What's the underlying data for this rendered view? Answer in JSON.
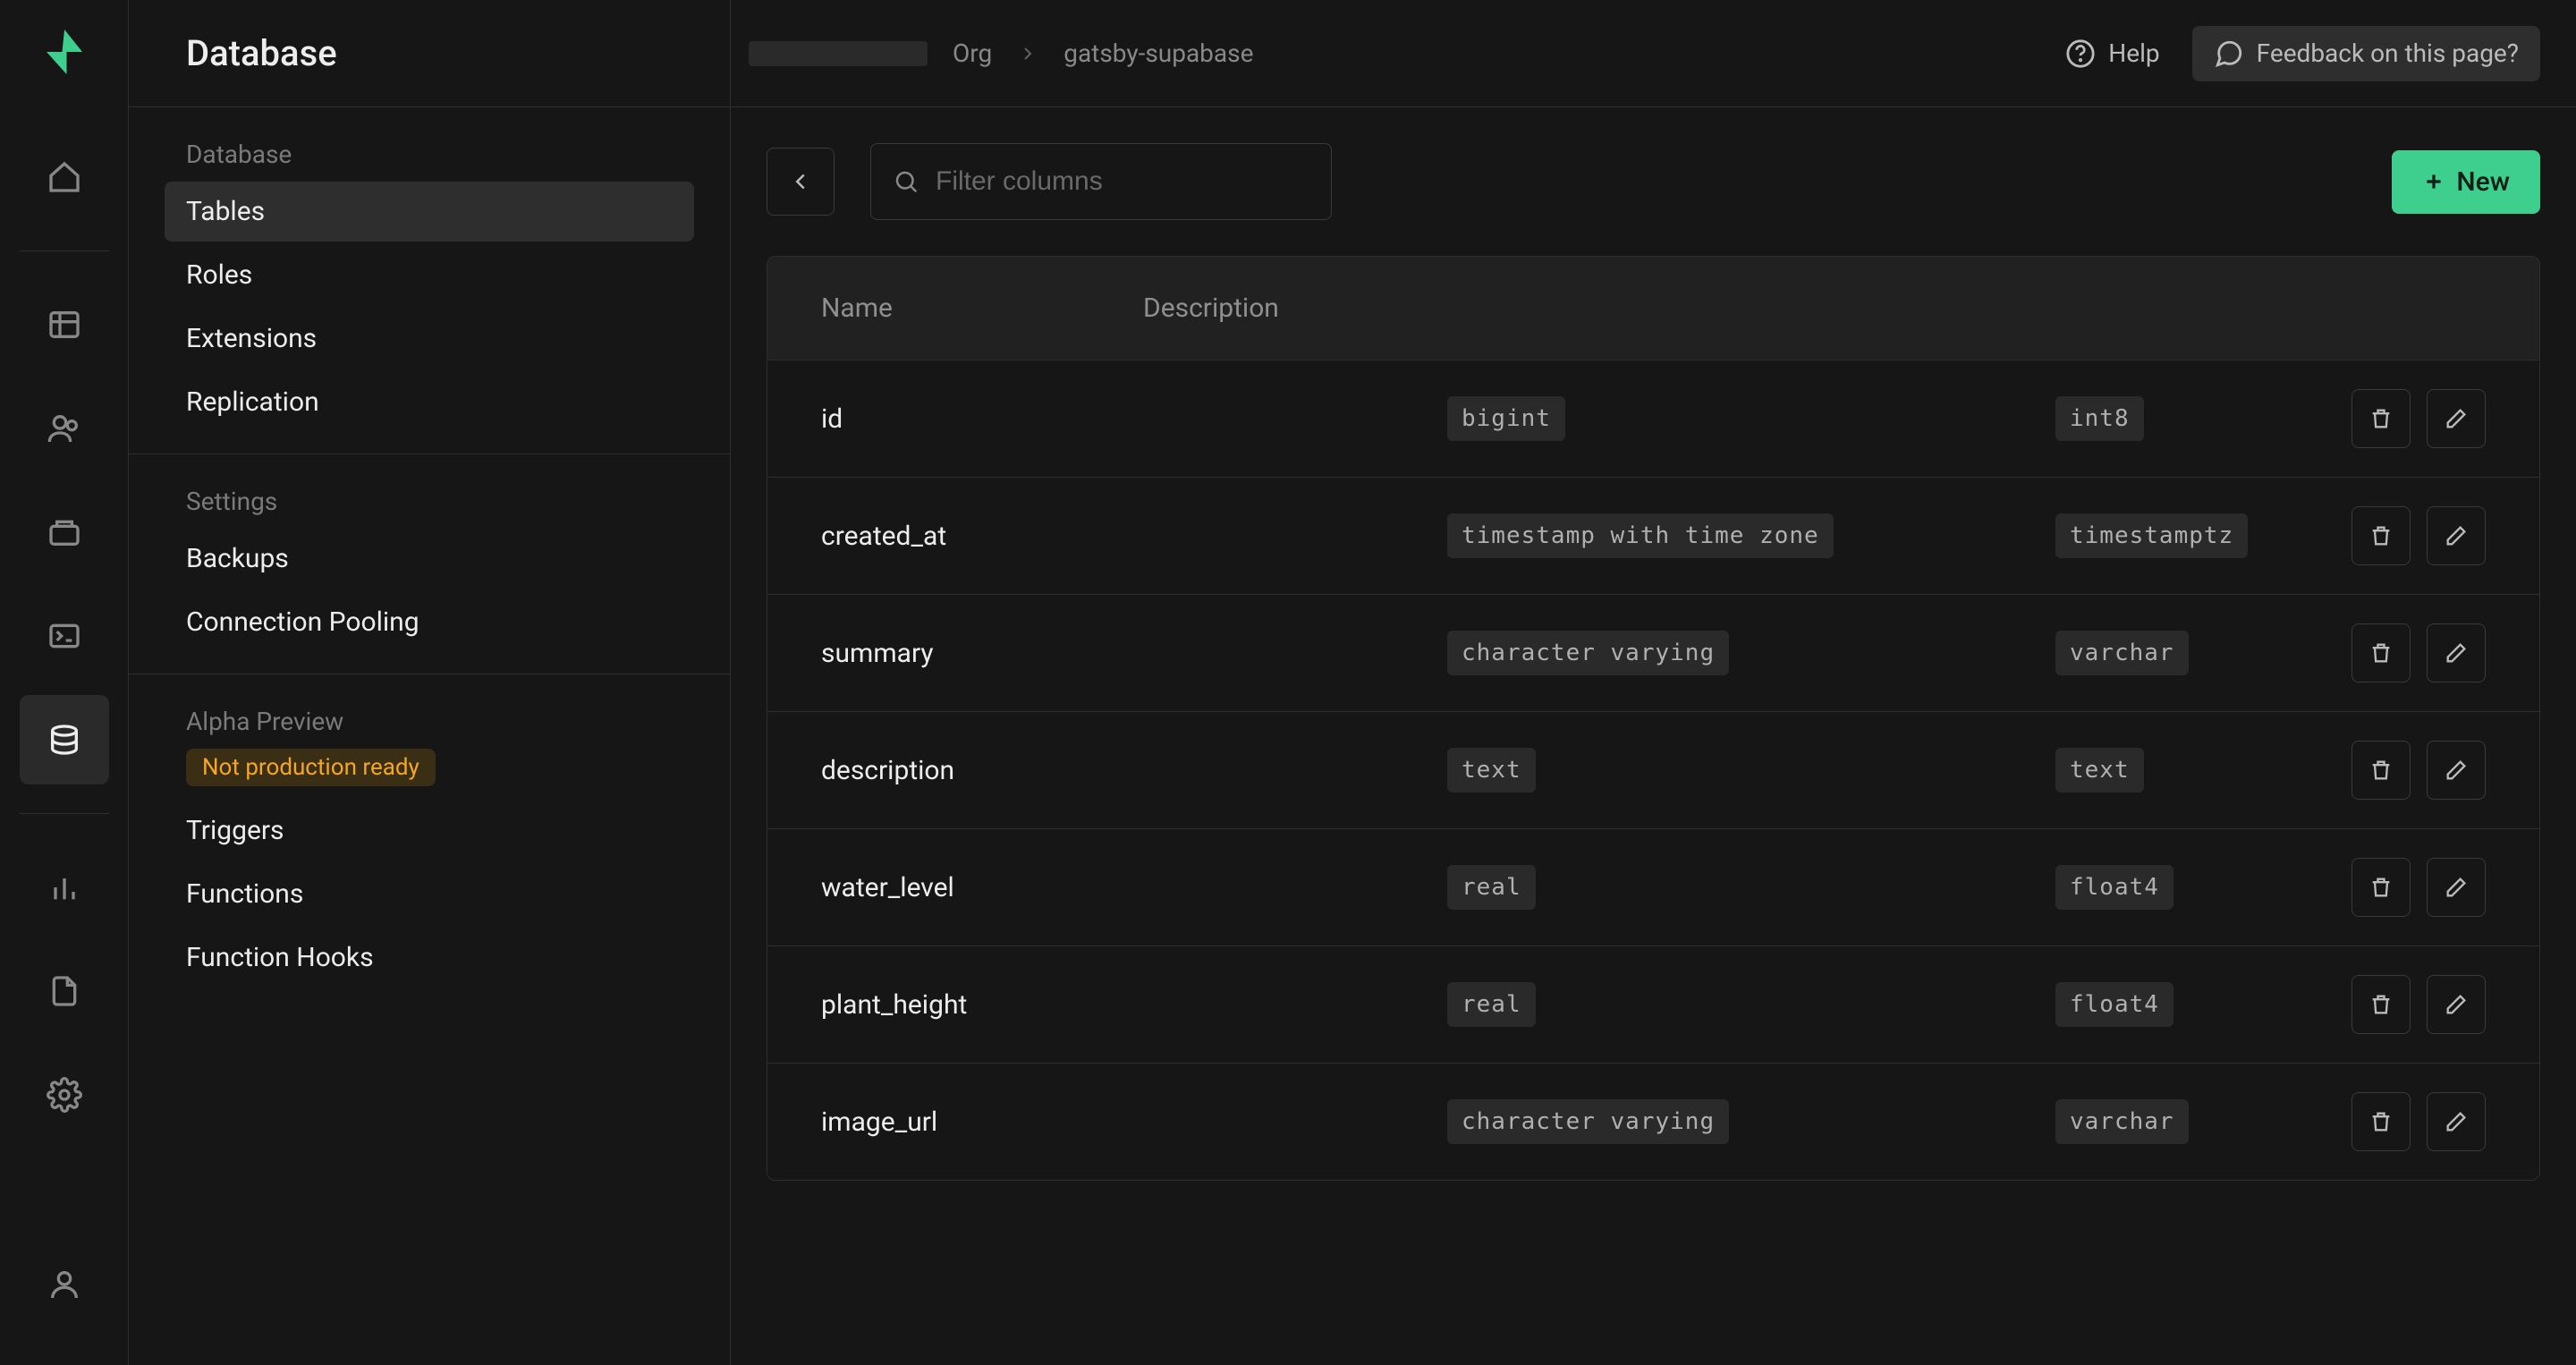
{
  "page_title": "Database",
  "breadcrumb": {
    "org": "Org",
    "project": "gatsby-supabase"
  },
  "topbar": {
    "help": "Help",
    "feedback": "Feedback on this page?"
  },
  "sidebar": {
    "sections": {
      "database": {
        "label": "Database",
        "items": [
          "Tables",
          "Roles",
          "Extensions",
          "Replication"
        ]
      },
      "settings": {
        "label": "Settings",
        "items": [
          "Backups",
          "Connection Pooling"
        ]
      },
      "alpha": {
        "label": "Alpha Preview",
        "badge": "Not production ready",
        "items": [
          "Triggers",
          "Functions",
          "Function Hooks"
        ]
      }
    }
  },
  "toolbar": {
    "search_placeholder": "Filter columns",
    "new_label": "New"
  },
  "columns_table": {
    "headers": {
      "name": "Name",
      "description": "Description"
    },
    "rows": [
      {
        "name": "id",
        "type": "bigint",
        "format": "int8"
      },
      {
        "name": "created_at",
        "type": "timestamp with time zone",
        "format": "timestamptz"
      },
      {
        "name": "summary",
        "type": "character varying",
        "format": "varchar"
      },
      {
        "name": "description",
        "type": "text",
        "format": "text"
      },
      {
        "name": "water_level",
        "type": "real",
        "format": "float4"
      },
      {
        "name": "plant_height",
        "type": "real",
        "format": "float4"
      },
      {
        "name": "image_url",
        "type": "character varying",
        "format": "varchar"
      }
    ]
  }
}
